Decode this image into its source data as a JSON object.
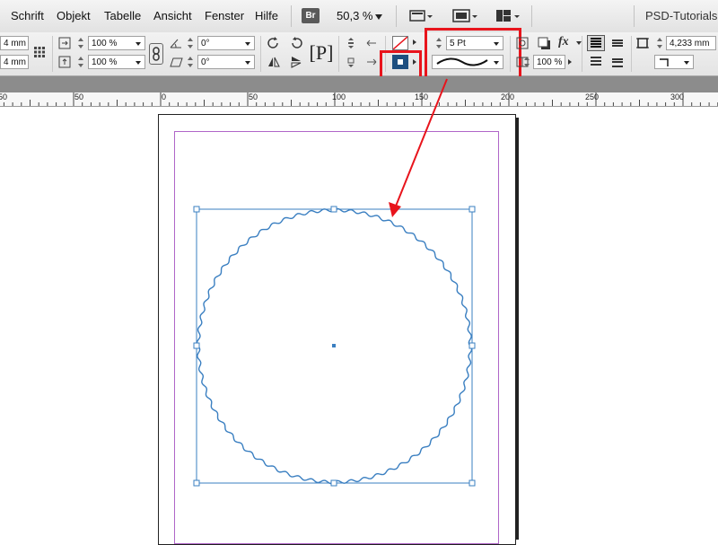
{
  "menu": {
    "items": [
      "Schrift",
      "Objekt",
      "Tabelle",
      "Ansicht",
      "Fenster",
      "Hilfe"
    ],
    "bridge_label": "Br",
    "zoom": "50,3 %",
    "brand": "PSD-Tutorials"
  },
  "control": {
    "x_value": "4 mm",
    "y_value": "4 mm",
    "scale_x": "100 %",
    "scale_y": "100 %",
    "rotate": "0°",
    "shear": "0°",
    "stroke_weight": "5 Pt",
    "opacity": "100 %",
    "gap_value": "4,233 mm",
    "fx_label": "fx"
  },
  "ruler": {
    "labels": [
      "50",
      "0",
      "50",
      "100",
      "150",
      "200",
      "250",
      "300"
    ]
  },
  "colors": {
    "accent_red": "#e8141c",
    "selection": "#3a7fc1",
    "margin_guide": "#b066c8",
    "stroke_swatch": "#1e4f80"
  }
}
